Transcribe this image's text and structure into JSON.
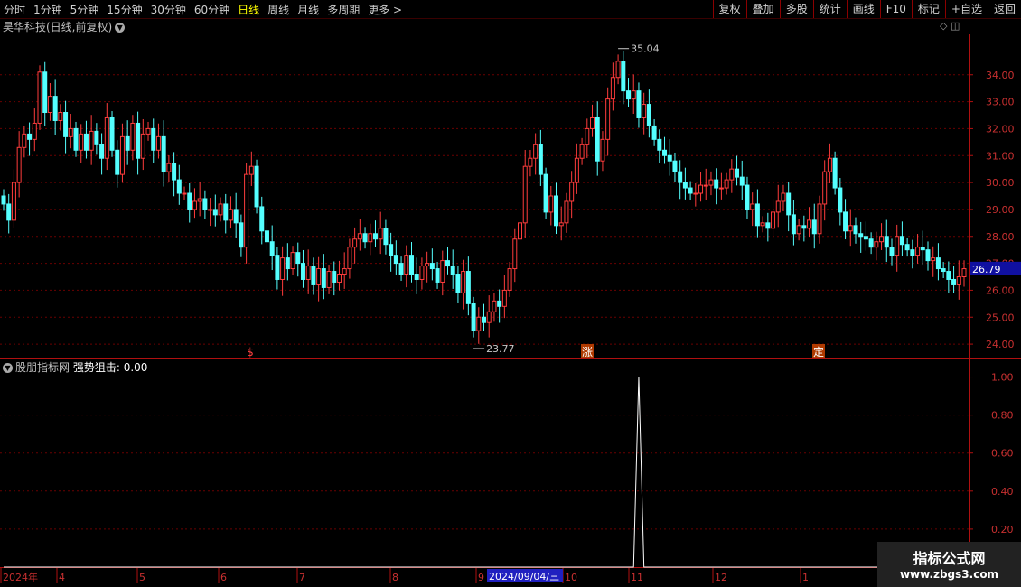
{
  "toolbar": {
    "period_tabs": [
      "分时",
      "1分钟",
      "5分钟",
      "15分钟",
      "30分钟",
      "60分钟",
      "日线",
      "周线",
      "月线",
      "多周期",
      "更多 >"
    ],
    "active_tab": 6,
    "right_buttons": [
      "复权",
      "叠加",
      "多股",
      "统计",
      "画线",
      "F10",
      "标记",
      "+自选",
      "返回"
    ]
  },
  "main_chart": {
    "title": "昊华科技(日线,前复权)",
    "y_ticks": [
      "34.00",
      "33.00",
      "32.00",
      "31.00",
      "30.00",
      "29.00",
      "28.00",
      "27.00",
      "26.00",
      "25.00",
      "24.00"
    ],
    "last_price": "26.79",
    "high_label": "35.04",
    "low_label": "23.77",
    "signal_markers": [
      "$",
      "涨",
      "定"
    ],
    "colors": {
      "up": "#ff3c3c",
      "down": "#54ffff",
      "axis": "#b01010",
      "grid": "#6a0000",
      "last_price_bg": "#1010a0",
      "signal_bg": "#b03a00"
    }
  },
  "sub_chart": {
    "title": "股朋指标网",
    "indicator": "强势狙击: 0.00",
    "y_ticks": [
      "1.00",
      "0.80",
      "0.60",
      "0.40",
      "0.20"
    ],
    "spike_value": 1.0
  },
  "x_axis": {
    "labels": [
      "2024年",
      "4",
      "5",
      "6",
      "7",
      "8",
      "9",
      "10",
      "11",
      "12",
      "1"
    ],
    "cursor_date": "2024/09/04/三"
  },
  "watermark": {
    "line1": "指标公式网",
    "line2": "www.zbgs3.com"
  },
  "chart_data": {
    "type": "candlestick",
    "ylim": [
      23.5,
      35.5
    ],
    "close": [
      29.2,
      28.6,
      30.0,
      31.3,
      31.8,
      31.6,
      32.2,
      34.1,
      32.6,
      33.2,
      32.3,
      32.6,
      31.7,
      32.0,
      31.2,
      31.8,
      31.2,
      31.9,
      31.4,
      30.9,
      32.4,
      31.2,
      30.3,
      31.7,
      31.2,
      32.2,
      30.9,
      31.8,
      32.0,
      31.2,
      31.7,
      30.4,
      30.7,
      30.1,
      29.6,
      29.6,
      29.0,
      29.3,
      29.4,
      29.0,
      29.0,
      28.8,
      29.2,
      28.6,
      29.0,
      28.5,
      27.6,
      30.3,
      30.6,
      29.1,
      28.2,
      27.8,
      27.3,
      26.4,
      27.2,
      26.8,
      27.4,
      27.0,
      26.4,
      26.9,
      26.2,
      26.8,
      26.1,
      26.7,
      26.3,
      26.6,
      26.8,
      27.6,
      27.9,
      28.1,
      27.8,
      28.1,
      27.9,
      28.3,
      27.7,
      27.3,
      27.0,
      26.6,
      27.3,
      26.6,
      26.4,
      26.9,
      27.0,
      26.8,
      26.3,
      27.1,
      26.9,
      26.6,
      25.9,
      26.7,
      25.5,
      24.5,
      25.0,
      24.8,
      25.2,
      25.6,
      25.4,
      26.0,
      26.8,
      27.9,
      28.5,
      30.6,
      30.9,
      31.4,
      30.3,
      28.9,
      29.5,
      28.4,
      28.5,
      29.3,
      30.0,
      30.9,
      31.4,
      32.0,
      32.4,
      30.8,
      31.6,
      33.1,
      33.9,
      34.5,
      33.4,
      33.1,
      33.4,
      32.4,
      32.9,
      32.1,
      31.6,
      31.2,
      31.0,
      30.8,
      30.4,
      30.0,
      29.8,
      29.6,
      29.6,
      29.9,
      29.9,
      30.1,
      29.8,
      29.8,
      30.1,
      30.5,
      30.2,
      29.9,
      29.0,
      29.2,
      28.4,
      28.5,
      28.3,
      28.9,
      29.3,
      29.6,
      28.8,
      28.1,
      28.4,
      28.3,
      28.6,
      28.1,
      29.2,
      30.4,
      30.9,
      29.8,
      28.9,
      28.2,
      28.4,
      28.1,
      28.0,
      27.9,
      27.6,
      27.8,
      28.0,
      27.6,
      27.3,
      28.0,
      27.7,
      27.5,
      27.3,
      27.6,
      27.5,
      27.1,
      27.2,
      26.8,
      26.7,
      26.4,
      26.2,
      26.5,
      26.8
    ]
  }
}
